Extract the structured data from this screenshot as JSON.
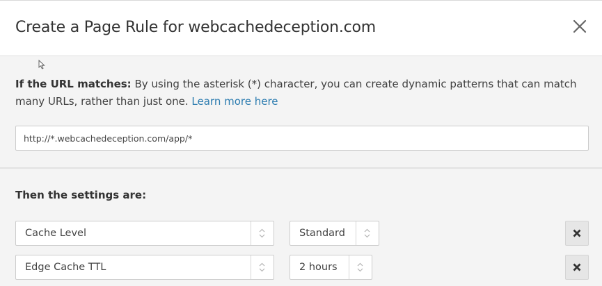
{
  "dialog": {
    "title": "Create a Page Rule for webcachedeception.com",
    "close_icon": "close-icon"
  },
  "url_section": {
    "label": "If the URL matches:",
    "description": " By using the asterisk (*) character, you can create dynamic patterns that can match many URLs, rather than just one. ",
    "learn_more": "Learn more here",
    "url_value": "http://*.webcachedeception.com/app/*"
  },
  "settings": {
    "heading": "Then the settings are:",
    "rows": [
      {
        "setting": "Cache Level",
        "value": "Standard",
        "remove_icon": "remove-icon"
      },
      {
        "setting": "Edge Cache TTL",
        "value": "2 hours",
        "remove_icon": "remove-icon"
      }
    ]
  },
  "colors": {
    "link": "#2c7cb0",
    "panel_bg": "#f4f4f4",
    "remove_bg": "#e6e6e6"
  }
}
